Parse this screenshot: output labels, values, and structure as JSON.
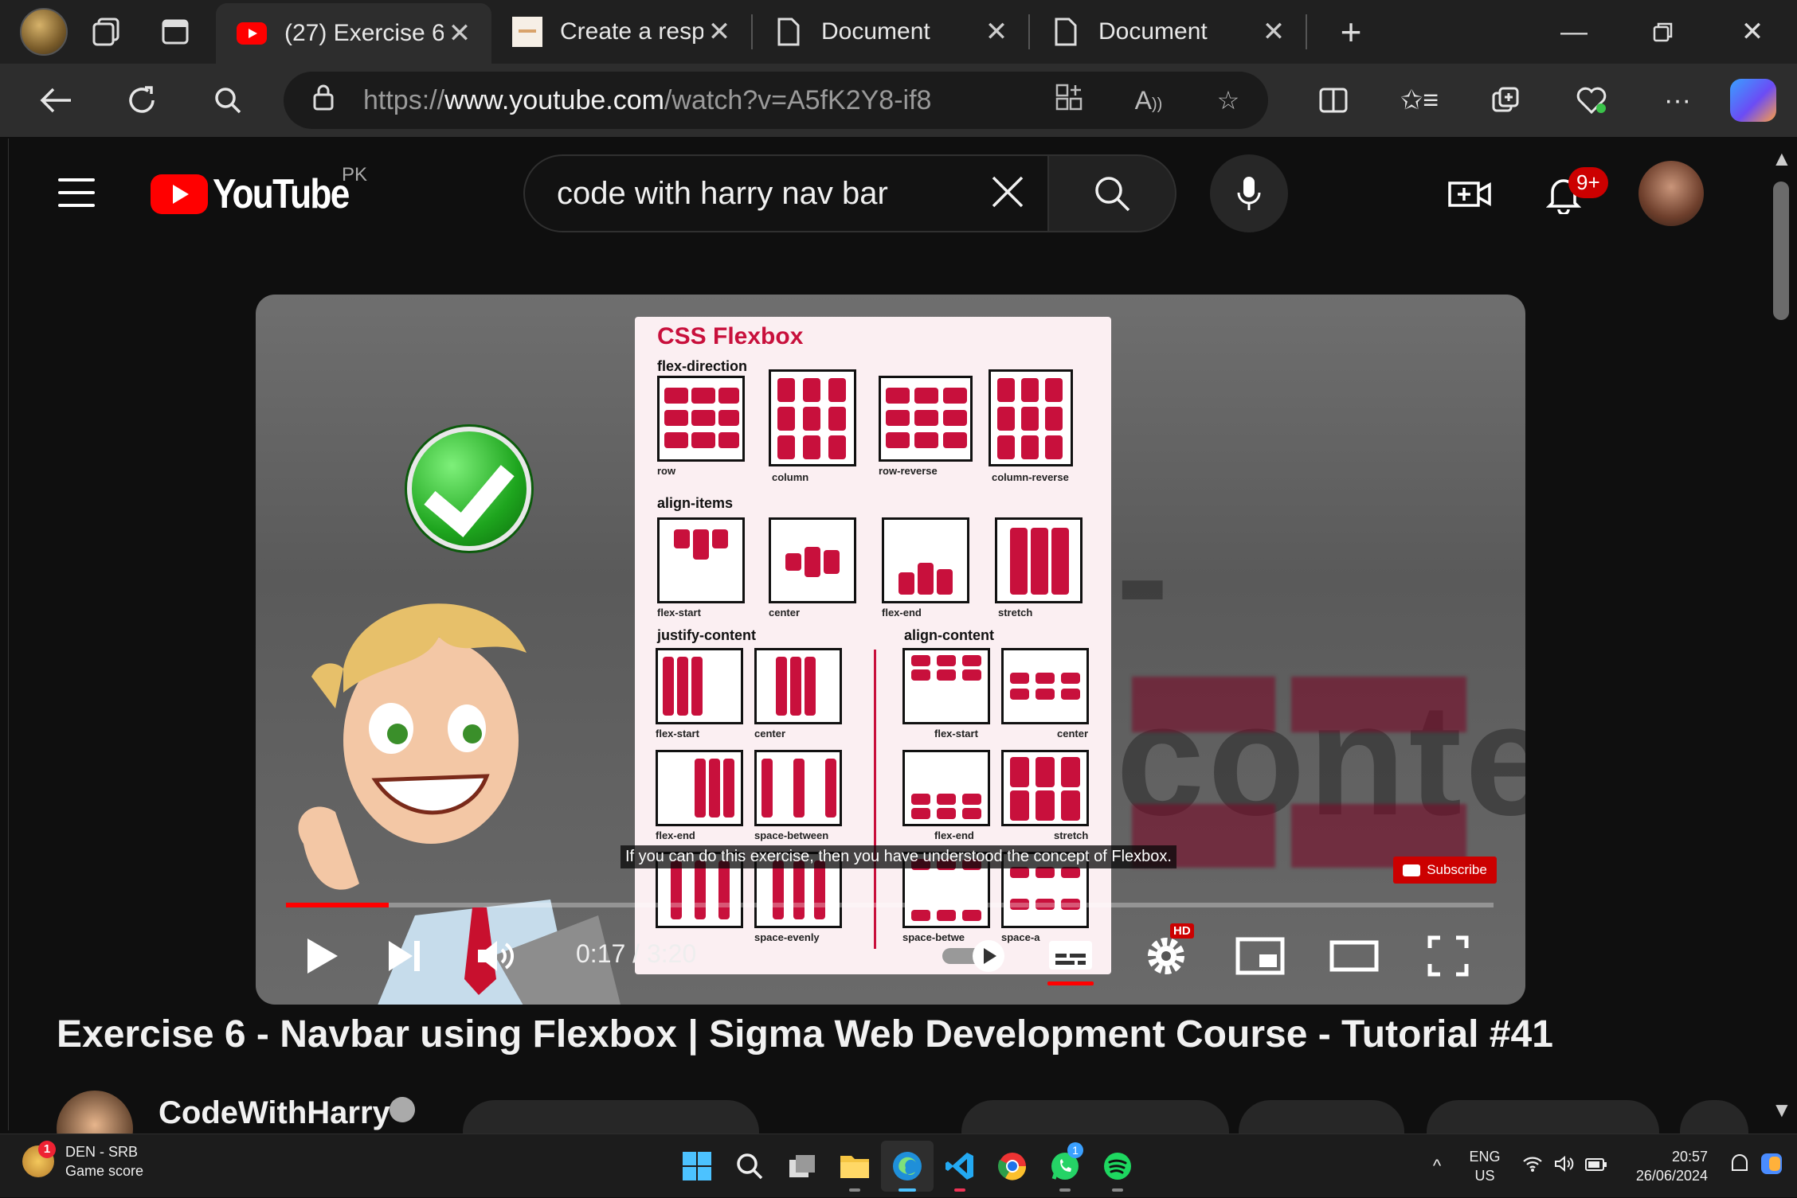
{
  "browser": {
    "tabs": [
      {
        "title": "(27) Exercise 6",
        "active": true,
        "favicon": "youtube-icon"
      },
      {
        "title": "Create a respo",
        "active": false,
        "favicon": "site-icon"
      },
      {
        "title": "Document",
        "active": false,
        "favicon": "document-icon"
      },
      {
        "title": "Document",
        "active": false,
        "favicon": "document-icon"
      }
    ],
    "url_prefix": "https://",
    "url_host": "www.youtube.com",
    "url_path": "/watch?v=A5fK2Y8-if8"
  },
  "youtube": {
    "logo_text": "YouTube",
    "country_code": "PK",
    "search_query": "code with harry nav bar",
    "notification_count": "9+",
    "video": {
      "sheet_title": "CSS Flexbox",
      "sections": {
        "flex_direction": "flex-direction",
        "align_items": "align-items",
        "justify_content": "justify-content",
        "align_content": "align-content"
      },
      "captions": {
        "row": "row",
        "column": "column",
        "row_reverse": "row-reverse",
        "column_reverse": "column-reverse",
        "ai_flex_start": "flex-start",
        "ai_center": "center",
        "ai_flex_end": "flex-end",
        "ai_stretch": "stretch",
        "jc_flex_start": "flex-start",
        "jc_center": "center",
        "jc_flex_end": "flex-end",
        "jc_space_between": "space-between",
        "jc_space_evenly": "space-evenly",
        "ac_flex_start": "flex-start",
        "ac_center": "center",
        "ac_flex_end": "flex-end",
        "ac_stretch": "stretch",
        "ac_space_between": "space-betwe",
        "ac_space_around": "space-a"
      },
      "subtitle": "If you can do this exercise, then you have understood the concept of Flexbox.",
      "subscribe_label": "Subscribe",
      "current_time": "0:17",
      "duration": "3:20",
      "time_display": "0:17 / 3:20",
      "progress": 0.085,
      "hd_badge": "HD"
    },
    "title": "Exercise 6 - Navbar using Flexbox | Sigma Web Development Course - Tutorial #41",
    "channel": "CodeWithHarry"
  },
  "taskbar": {
    "weather_title": "DEN - SRB",
    "weather_sub": "Game score",
    "weather_badge": "1",
    "lang_top": "ENG",
    "lang_bottom": "US",
    "time": "20:57",
    "date": "26/06/2024",
    "whatsapp_badge": "1"
  },
  "colors": {
    "youtube_red": "#ff0000",
    "flexbox_red": "#c8103c",
    "progress_red": "#ff0000",
    "edge_accent": "#4cc2ff"
  }
}
